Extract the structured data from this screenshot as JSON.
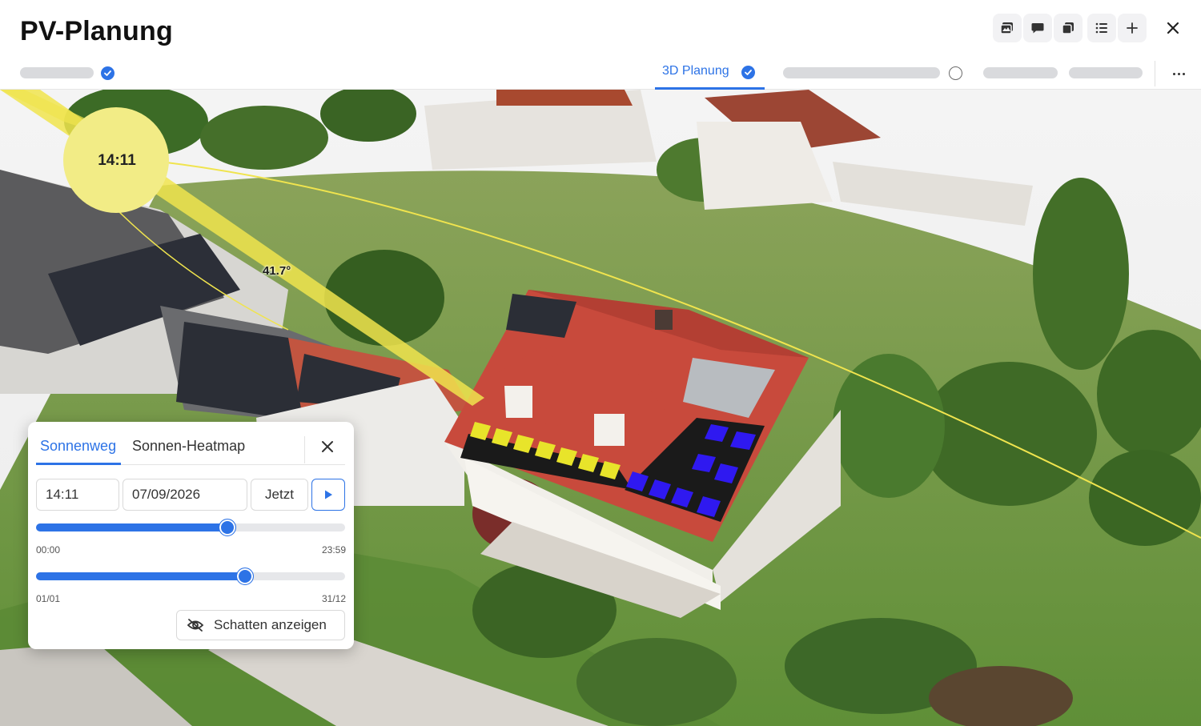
{
  "app": {
    "title": "PV-Planung"
  },
  "toolbar": {
    "buttons": [
      {
        "name": "gallery-icon"
      },
      {
        "name": "comment-icon"
      },
      {
        "name": "layers-icon"
      },
      {
        "name": "list-icon"
      },
      {
        "name": "plus-icon"
      }
    ],
    "close": "close-icon"
  },
  "steps": {
    "active_label": "3D Planung"
  },
  "scene": {
    "sun_time": "14:11",
    "sun_angle": "41.7°",
    "colors": {
      "sun": "#f1ea7a",
      "sun_path": "#f0e44e",
      "panel_yellow": "#e8e42a",
      "panel_blue": "#2f19f0",
      "roof": "#c4463a",
      "grass": "#6e9b43"
    }
  },
  "panel": {
    "tabs": [
      "Sonnenweg",
      "Sonnen-Heatmap"
    ],
    "active_tab": "Sonnenweg",
    "time_value": "14:11",
    "date_value": "07/09/2026",
    "now_label": "Jetzt",
    "time_slider": {
      "min_label": "00:00",
      "max_label": "23:59",
      "value_fraction": 0.62
    },
    "date_slider": {
      "min_label": "01/01",
      "max_label": "31/12",
      "value_fraction": 0.675
    },
    "shadow_button_label": "Schatten anzeigen"
  }
}
